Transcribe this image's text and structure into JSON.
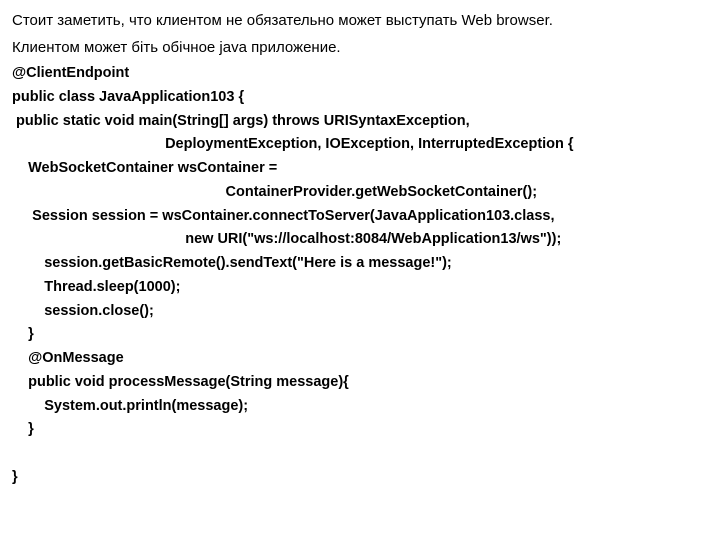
{
  "intro": {
    "line1": "Стоит заметить, что клиентом не обязательно может выступать Web browser.",
    "line2": "Клиентом может біть обічное java приложение."
  },
  "code": {
    "l1": "@ClientEndpoint",
    "l2": "public class JavaApplication103 {",
    "l3": " public static void main(String[] args) throws URISyntaxException, ",
    "l4": "                                      DeploymentException, IOException, InterruptedException {",
    "l5": "    WebSocketContainer wsContainer = ",
    "l6": "                                                     ContainerProvider.getWebSocketContainer();",
    "l7": "     Session session = wsContainer.connectToServer(JavaApplication103.class,",
    "l8": "                                           new URI(\"ws://localhost:8084/WebApplication13/ws\"));",
    "l9": "        session.getBasicRemote().sendText(\"Here is a message!\");",
    "l10": "        Thread.sleep(1000);",
    "l11": "        session.close();",
    "l12": "    }",
    "l13": "    @OnMessage",
    "l14": "    public void processMessage(String message){",
    "l15": "        System.out.println(message);",
    "l16": "    }",
    "l17": " ",
    "l18": "}"
  }
}
